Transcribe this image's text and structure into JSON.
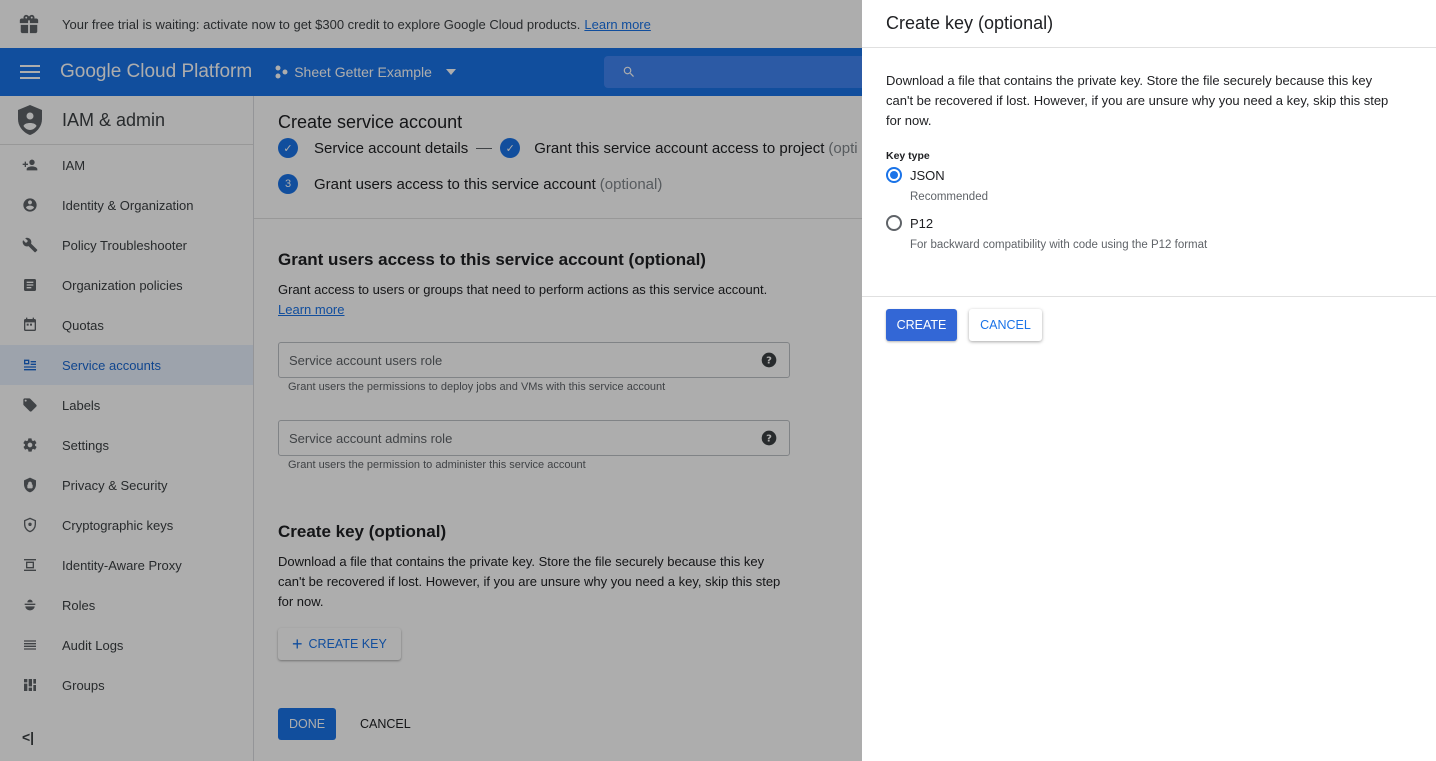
{
  "trial_banner": {
    "text": "Your free trial is waiting: activate now to get $300 credit to explore Google Cloud products.",
    "link": "Learn more"
  },
  "topbar": {
    "brand": "Google Cloud Platform",
    "project": "Sheet Getter Example"
  },
  "sidebar": {
    "title": "IAM & admin",
    "items": [
      {
        "label": "IAM",
        "icon": "person-add-icon"
      },
      {
        "label": "Identity & Organization",
        "icon": "account-circle-icon"
      },
      {
        "label": "Policy Troubleshooter",
        "icon": "wrench-icon"
      },
      {
        "label": "Organization policies",
        "icon": "document-icon"
      },
      {
        "label": "Quotas",
        "icon": "calendar-icon"
      },
      {
        "label": "Service accounts",
        "icon": "service-account-icon"
      },
      {
        "label": "Labels",
        "icon": "tag-icon"
      },
      {
        "label": "Settings",
        "icon": "gear-icon"
      },
      {
        "label": "Privacy & Security",
        "icon": "shield-icon"
      },
      {
        "label": "Cryptographic keys",
        "icon": "key-shield-icon"
      },
      {
        "label": "Identity-Aware Proxy",
        "icon": "proxy-icon"
      },
      {
        "label": "Roles",
        "icon": "roles-icon"
      },
      {
        "label": "Audit Logs",
        "icon": "list-icon"
      },
      {
        "label": "Groups",
        "icon": "groups-icon"
      }
    ],
    "collapse": "<|"
  },
  "main": {
    "title": "Create service account",
    "step1": "Service account details",
    "step2": "Grant this service account access to project",
    "step2_opt": "(opti",
    "step3_num": "3",
    "step3": "Grant users access to this service account",
    "step3_opt": "(optional)",
    "grant_title": "Grant users access to this service account (optional)",
    "grant_text": "Grant access to users or groups that need to perform actions as this service account.",
    "grant_link": "Learn more",
    "users_role_placeholder": "Service account users role",
    "users_role_hint": "Grant users the permissions to deploy jobs and VMs with this service account",
    "admins_role_placeholder": "Service account admins role",
    "admins_role_hint": "Grant users the permission to administer this service account",
    "key_title": "Create key (optional)",
    "key_text": "Download a file that contains the private key. Store the file securely because this key can't be recovered if lost. However, if you are unsure why you need a key, skip this step for now.",
    "create_key_btn": "CREATE KEY",
    "done_btn": "DONE",
    "cancel_btn": "CANCEL"
  },
  "panel": {
    "title": "Create key (optional)",
    "description": "Download a file that contains the private key. Store the file securely because this key can't be recovered if lost. However, if you are unsure why you need a key, skip this step for now.",
    "key_type_label": "Key type",
    "options": [
      {
        "label": "JSON",
        "sub": "Recommended",
        "selected": true
      },
      {
        "label": "P12",
        "sub": "For backward compatibility with code using the P12 format",
        "selected": false
      }
    ],
    "create_btn": "CREATE",
    "cancel_btn": "CANCEL"
  },
  "colors": {
    "primary": "#1a73e8",
    "create_button": "#3367d6"
  }
}
